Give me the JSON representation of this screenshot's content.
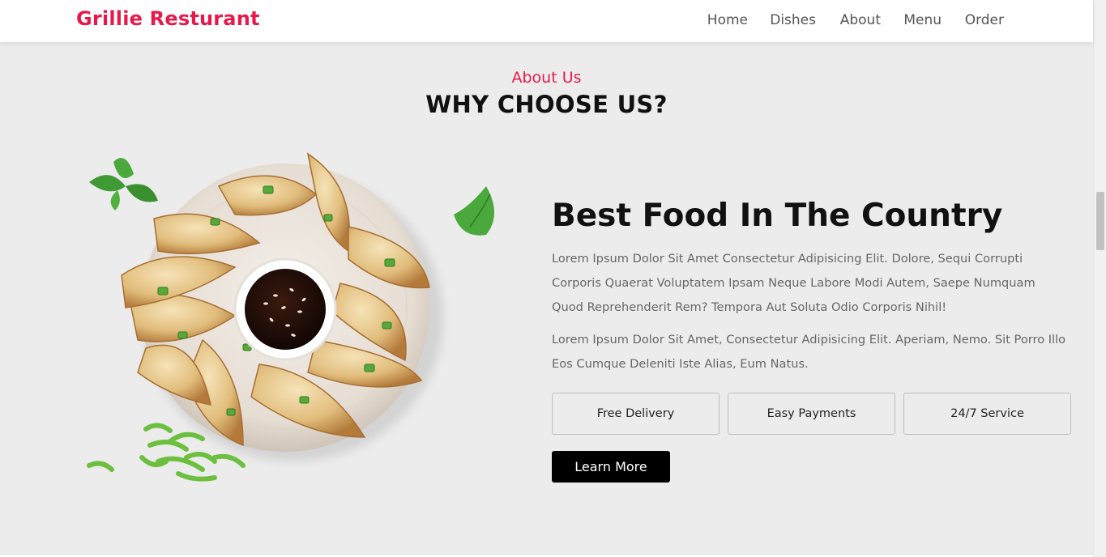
{
  "header": {
    "brand": "Grillie Resturant",
    "nav": [
      "Home",
      "Dishes",
      "About",
      "Menu",
      "Order"
    ]
  },
  "section": {
    "subheading": "About Us",
    "heading": "WHY CHOOSE US?"
  },
  "content": {
    "title": "Best Food In The Country",
    "paragraph_1": "Lorem Ipsum Dolor Sit Amet Consectetur Adipisicing Elit. Dolore, Sequi Corrupti Corporis Quaerat Voluptatem Ipsam Neque Labore Modi Autem, Saepe Numquam Quod Reprehenderit Rem? Tempora Aut Soluta Odio Corporis Nihil!",
    "paragraph_2": "Lorem Ipsum Dolor Sit Amet, Consectetur Adipisicing Elit. Aperiam, Nemo. Sit Porro Illo Eos Cumque Deleniti Iste Alias, Eum Natus.",
    "features": [
      "Free Delivery",
      "Easy Payments",
      "24/7 Service"
    ],
    "cta": "Learn More"
  },
  "image": {
    "subject": "dumplings-plate-with-soy-sauce",
    "icons": [
      "mint-leaf-icon",
      "green-onion-icon"
    ]
  },
  "colors": {
    "accent": "#e8194a",
    "background": "#ececec",
    "button": "#000000"
  }
}
